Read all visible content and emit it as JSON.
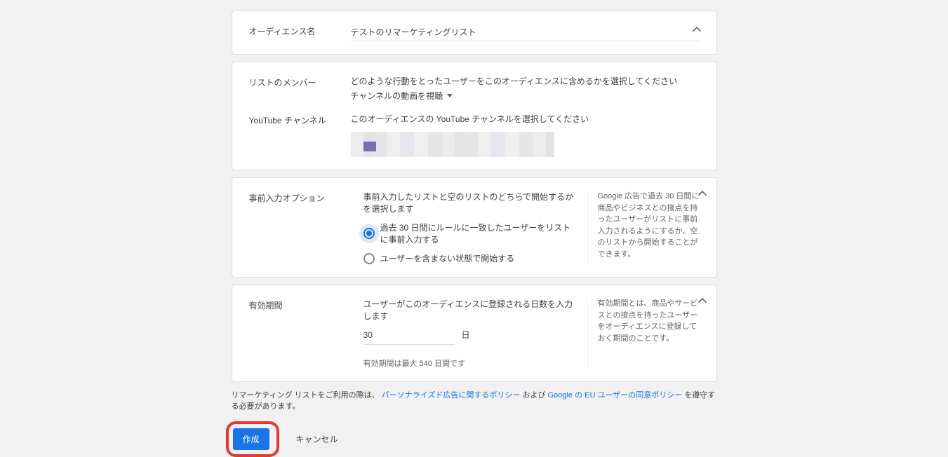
{
  "colors": {
    "accent": "#1a73e8",
    "highlight": "#e53935"
  },
  "audience_name": {
    "label": "オーディエンス名",
    "value": "テストのリマーケティングリスト"
  },
  "list_members": {
    "label": "リストのメンバー",
    "helptext": "どのような行動をとったユーザーをこのオーディエンスに含めるかを選択してください",
    "dropdown_value": "チャンネルの動画を視聴"
  },
  "youtube_channel": {
    "label": "YouTube チャンネル",
    "helptext": "このオーディエンスの YouTube チャンネルを選択してください"
  },
  "prefill": {
    "label": "事前入力オプション",
    "helptext": "事前入力したリストと空のリストのどちらで開始するかを選択します",
    "option_prefill": "過去 30 日間にルールに一致したユーザーをリストに事前入力する",
    "option_empty": "ユーザーを含まない状態で開始する",
    "side_help": "Google 広告で過去 30 日間に商品やビジネスとの接点を持ったユーザーがリストに事前入力されるようにするか、空のリストから開始することができます。"
  },
  "duration": {
    "label": "有効期間",
    "helptext": "ユーザーがこのオーディエンスに登録される日数を入力します",
    "value": "30",
    "unit": "日",
    "helper": "有効期間は最大 540 日間です",
    "side_help": "有効期間とは、商品やサービスとの接点を持ったユーザーをオーディエンスに登録しておく期間のことです。"
  },
  "policy": {
    "prefix": "リマーケティング リストをご利用の際は、",
    "link1": "パーソナライズド広告に関するポリシー",
    "mid": "および",
    "link2": "Google の EU ユーザーの同意ポリシー",
    "suffix": "を遵守する必要があります。"
  },
  "actions": {
    "create": "作成",
    "cancel": "キャンセル"
  }
}
